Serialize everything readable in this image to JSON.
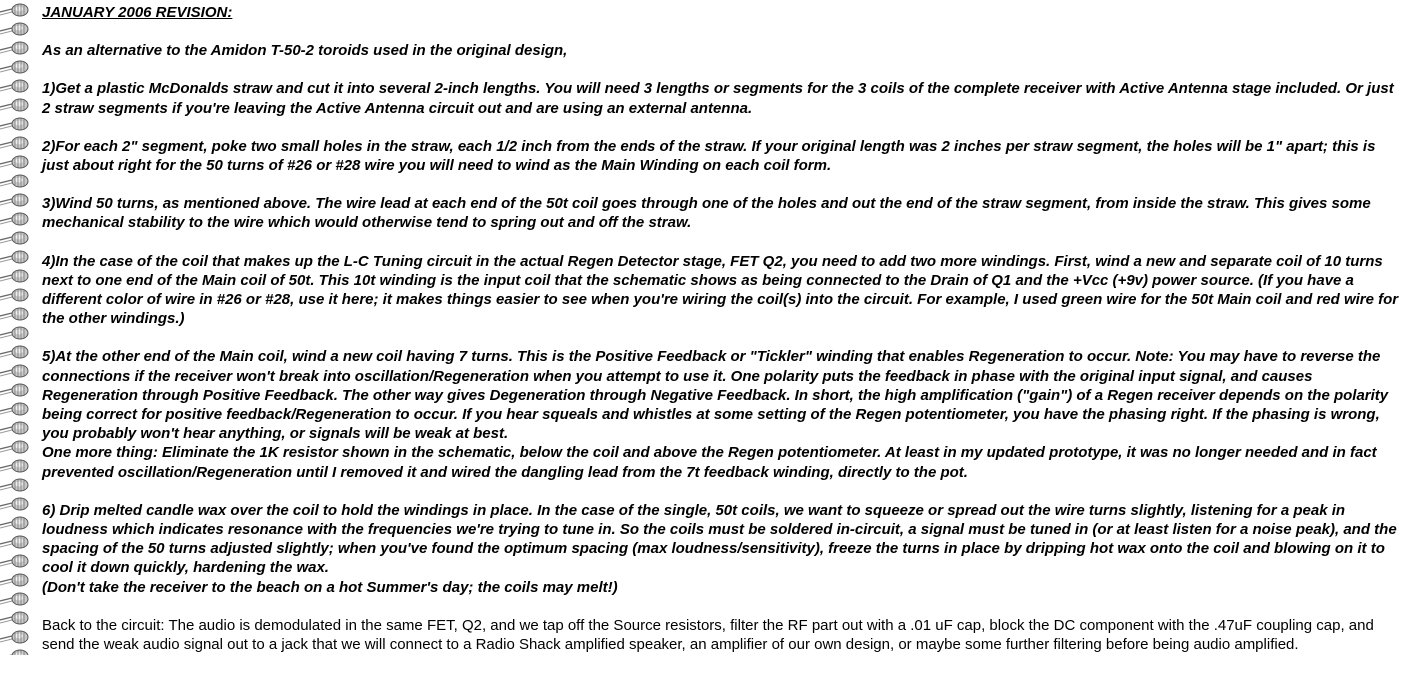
{
  "page": {
    "background_color": "#ffffff",
    "text_color": "#000000",
    "tile_icon": "coil-icon"
  },
  "article": {
    "title": "JANUARY 2006 REVISION:",
    "intro": "As an alternative to the Amidon T-50-2 toroids used in the original design,",
    "step1": "1)Get a plastic McDonalds straw and cut it into several 2-inch lengths. You will need 3 lengths or segments for the 3 coils of the complete receiver with Active Antenna stage included. Or just 2 straw segments if you're leaving the Active Antenna circuit out and are using an external antenna.",
    "step2": "2)For each 2\" segment, poke two small holes in the straw, each 1/2 inch from the ends of the straw. If your original length was 2 inches per straw segment, the holes will be 1\" apart; this is just about right for the 50 turns of #26 or #28 wire you will need to wind as the Main Winding on each coil form.",
    "step3": "3)Wind 50 turns, as mentioned above. The wire lead at each end of the 50t coil goes through one of the holes and out the end of the straw segment, from inside the straw. This gives some mechanical stability to the wire which would otherwise tend to spring out and off the straw.",
    "step4": "4)In the case of the coil that makes up the L-C Tuning circuit in the actual Regen Detector stage, FET Q2, you need to add two more windings. First, wind a new and separate coil of 10 turns next to one end of the Main coil of 50t. This 10t winding is the input coil that the schematic shows as being connected to the Drain of Q1 and the +Vcc (+9v) power source. (If you have a different color of wire in #26 or #28, use it here; it makes things easier to see when you're wiring the coil(s) into the circuit. For example, I used green wire for the 50t Main coil and red wire for the other windings.)",
    "step5": "5)At the other end of the Main coil, wind a new coil having 7 turns. This is the Positive Feedback or \"Tickler\" winding that enables Regeneration to occur. Note: You may have to reverse the connections if the receiver won't break into oscillation/Regeneration when you attempt to use it. One polarity puts the feedback in phase with the original input signal, and causes Regeneration through Positive Feedback. The other way gives Degeneration through Negative Feedback. In short, the high amplification (\"gain\") of a Regen receiver depends on the polarity being correct for positive feedback/Regeneration to occur. If you hear squeals and whistles at some setting of the Regen potentiometer, you have the phasing right. If the phasing is wrong, you probably won't hear anything, or signals will be weak at best.",
    "step5_extra": "One more thing: Eliminate the 1K resistor shown in the schematic, below the coil and above the Regen potentiometer. At least in my updated prototype, it was no longer needed and in fact prevented oscillation/Regeneration until I removed it and wired the dangling lead from the 7t feedback winding, directly to the pot.",
    "step6": "6) Drip melted candle wax over the coil to hold the windings in place. In the case of the single, 50t coils, we want to squeeze or spread out the wire turns slightly, listening for a peak in loudness which indicates resonance with the frequencies we're trying to tune in. So the coils must be soldered in-circuit, a signal must be tuned in (or at least listen for a noise peak), and the spacing of the 50 turns adjusted slightly; when you've found the optimum spacing (max loudness/sensitivity), freeze the turns in place by dripping hot wax onto the coil and blowing on it to cool it down quickly, hardening the wax.",
    "step6_note": "(Don't take the receiver to the beach on a hot Summer's day; the coils may melt!)",
    "closing": "Back to the circuit: The audio is demodulated in the same FET, Q2, and we tap off the Source resistors, filter the RF part out with a .01 uF cap, block the DC component with the .47uF coupling cap, and send the weak audio signal out to a jack that we will connect to a Radio Shack amplified speaker, an amplifier of our own design, or maybe some further filtering before being audio amplified."
  }
}
